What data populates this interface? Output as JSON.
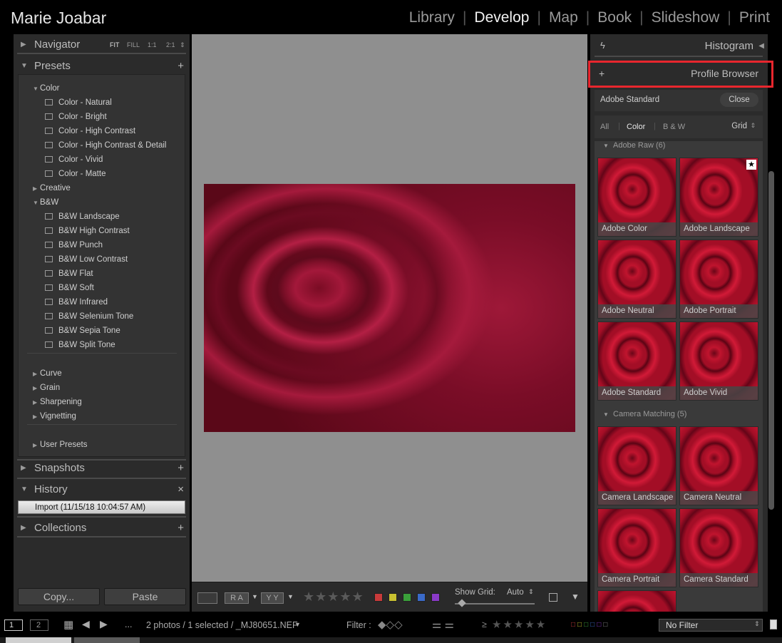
{
  "identity_plate": "Marie Joabar",
  "modules": [
    "Library",
    "Develop",
    "Map",
    "Book",
    "Slideshow",
    "Print"
  ],
  "active_module": "Develop",
  "left_panel": {
    "navigator": {
      "title": "Navigator",
      "zoom": [
        "FIT",
        "FILL",
        "1:1",
        "2:1"
      ]
    },
    "presets": {
      "title": "Presets",
      "add_icon": "plus-icon",
      "groups": [
        {
          "label": "Color",
          "expanded": true,
          "items": [
            "Color - Natural",
            "Color - Bright",
            "Color - High Contrast",
            "Color - High Contrast & Detail",
            "Color - Vivid",
            "Color - Matte"
          ]
        },
        {
          "label": "Creative",
          "expanded": false,
          "items": []
        },
        {
          "label": "B&W",
          "expanded": true,
          "items": [
            "B&W Landscape",
            "B&W High Contrast",
            "B&W Punch",
            "B&W Low Contrast",
            "B&W Flat",
            "B&W Soft",
            "B&W Infrared",
            "B&W Selenium Tone",
            "B&W Sepia Tone",
            "B&W Split Tone"
          ]
        },
        {
          "label": "Curve",
          "expanded": false,
          "items": []
        },
        {
          "label": "Grain",
          "expanded": false,
          "items": []
        },
        {
          "label": "Sharpening",
          "expanded": false,
          "items": []
        },
        {
          "label": "Vignetting",
          "expanded": false,
          "items": []
        },
        {
          "label": "User Presets",
          "expanded": false,
          "items": []
        }
      ]
    },
    "snapshots": {
      "title": "Snapshots",
      "add": "+"
    },
    "history": {
      "title": "History",
      "clear": "×",
      "items": [
        "Import (11/15/18 10:04:57 AM)"
      ]
    },
    "collections": {
      "title": "Collections"
    },
    "copy_button": "Copy...",
    "paste_button": "Paste"
  },
  "toolbar": {
    "flag_labels": [
      "R A",
      "Y Y"
    ],
    "stars": "★★★★★",
    "color_labels": [
      "#c83a3a",
      "#c8c030",
      "#3aa03a",
      "#3a6ac8",
      "#8a3ac8"
    ],
    "show_grid_label": "Show Grid:",
    "show_grid_value": "Auto"
  },
  "right_panel": {
    "histogram_title": "Histogram",
    "profile_browser_title": "Profile Browser",
    "current_profile": "Adobe Standard",
    "close_button": "Close",
    "filters": [
      "All",
      "Color",
      "B & W"
    ],
    "active_filter": "Color",
    "view_mode": "Grid",
    "groups": [
      {
        "title": "Adobe Raw (6)",
        "profiles": [
          "Adobe Color",
          "Adobe Landscape",
          "Adobe Neutral",
          "Adobe Portrait",
          "Adobe Standard",
          "Adobe Vivid"
        ],
        "favorite": "Adobe Landscape"
      },
      {
        "title": "Camera Matching (5)",
        "profiles": [
          "Camera Landscape",
          "Camera Neutral",
          "Camera Portrait",
          "Camera Standard"
        ]
      }
    ]
  },
  "filmstrip": {
    "pages": [
      "1",
      "2"
    ],
    "ellipsis": "...",
    "selection_info": "2 photos / 1 selected / _MJ80651.NEF",
    "filter_label": "Filter :",
    "filter_value": "No Filter",
    "ge_symbol": "≥"
  }
}
